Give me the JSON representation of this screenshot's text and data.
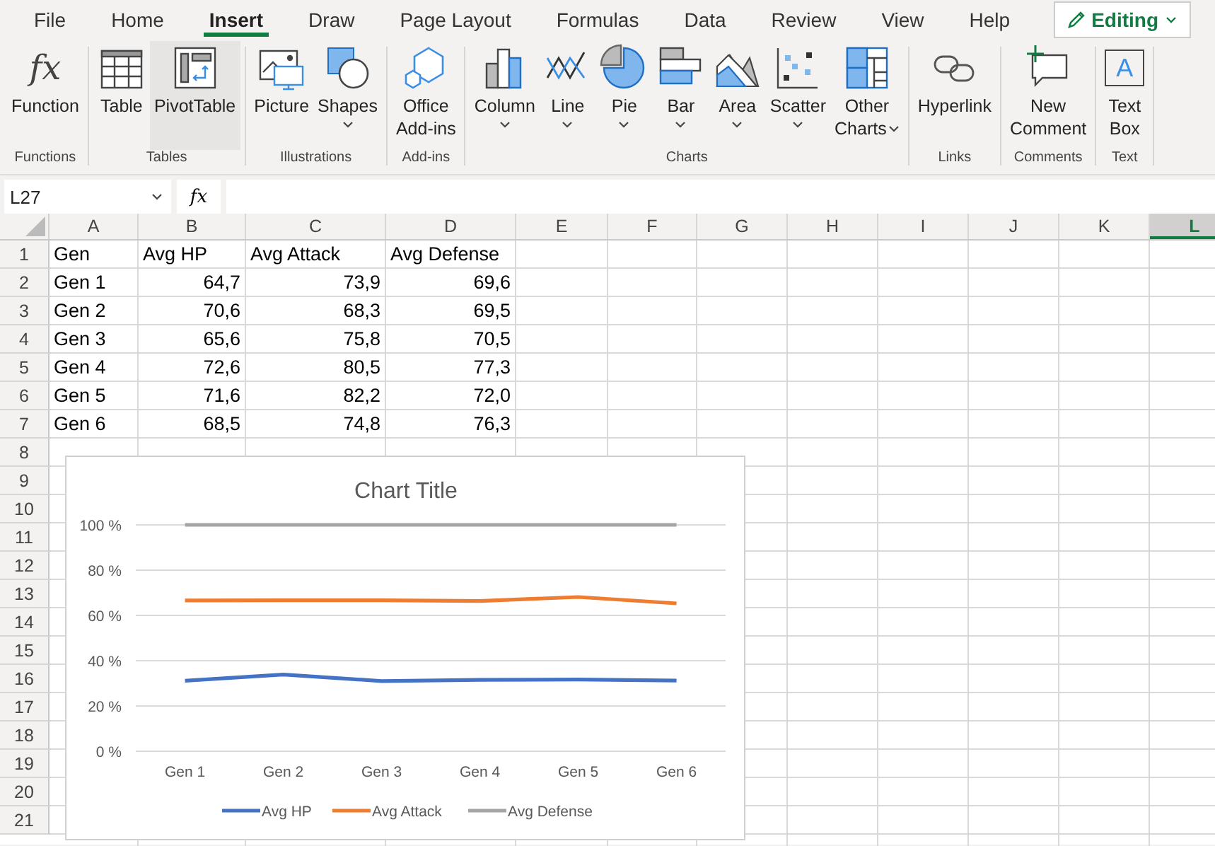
{
  "menu_tabs": [
    {
      "label": "File",
      "selected": false
    },
    {
      "label": "Home",
      "selected": false
    },
    {
      "label": "Insert",
      "selected": true
    },
    {
      "label": "Draw",
      "selected": false
    },
    {
      "label": "Page Layout",
      "selected": false
    },
    {
      "label": "Formulas",
      "selected": false
    },
    {
      "label": "Data",
      "selected": false
    },
    {
      "label": "Review",
      "selected": false
    },
    {
      "label": "View",
      "selected": false
    },
    {
      "label": "Help",
      "selected": false
    }
  ],
  "mode_button": {
    "label": "Editing"
  },
  "ribbon_groups": [
    {
      "label": "Functions",
      "items": [
        {
          "lines": [
            "Function"
          ],
          "glyph": "fx",
          "dropdown": false,
          "selected": false
        }
      ]
    },
    {
      "label": "Tables",
      "items": [
        {
          "lines": [
            "Table"
          ],
          "dropdown": false,
          "selected": false
        },
        {
          "lines": [
            "PivotTable"
          ],
          "dropdown": false,
          "selected": true
        }
      ]
    },
    {
      "label": "Illustrations",
      "items": [
        {
          "lines": [
            "Picture"
          ],
          "dropdown": false,
          "selected": false
        },
        {
          "lines": [
            "Shapes"
          ],
          "dropdown": true,
          "caret_inline": false,
          "selected": false
        }
      ]
    },
    {
      "label": "Add-ins",
      "items": [
        {
          "lines": [
            "Office",
            "Add-ins"
          ],
          "dropdown": false,
          "selected": false
        }
      ]
    },
    {
      "label": "Charts",
      "items": [
        {
          "lines": [
            "Column"
          ],
          "dropdown": true,
          "caret_inline": false,
          "selected": false
        },
        {
          "lines": [
            "Line"
          ],
          "dropdown": true,
          "caret_inline": false,
          "selected": false
        },
        {
          "lines": [
            "Pie"
          ],
          "dropdown": true,
          "caret_inline": false,
          "selected": false
        },
        {
          "lines": [
            "Bar"
          ],
          "dropdown": true,
          "caret_inline": false,
          "selected": false
        },
        {
          "lines": [
            "Area"
          ],
          "dropdown": true,
          "caret_inline": false,
          "selected": false
        },
        {
          "lines": [
            "Scatter"
          ],
          "dropdown": true,
          "caret_inline": false,
          "selected": false
        },
        {
          "lines": [
            "Other",
            "Charts"
          ],
          "dropdown": true,
          "caret_inline": true,
          "selected": false
        }
      ]
    },
    {
      "label": "Links",
      "items": [
        {
          "lines": [
            "Hyperlink"
          ],
          "dropdown": false,
          "selected": false
        }
      ]
    },
    {
      "label": "Comments",
      "items": [
        {
          "lines": [
            "New",
            "Comment"
          ],
          "dropdown": false,
          "selected": false
        }
      ]
    },
    {
      "label": "Text",
      "items": [
        {
          "lines": [
            "Text",
            "Box"
          ],
          "glyph": "A",
          "dropdown": false,
          "selected": false
        }
      ]
    }
  ],
  "formula_bar": {
    "name_box": "L27",
    "fx": "fx"
  },
  "sheet": {
    "columns": [
      {
        "label": "A",
        "selected": false
      },
      {
        "label": "B",
        "selected": false
      },
      {
        "label": "C",
        "selected": false
      },
      {
        "label": "D",
        "selected": false
      },
      {
        "label": "E",
        "selected": false
      },
      {
        "label": "F",
        "selected": false
      },
      {
        "label": "G",
        "selected": false
      },
      {
        "label": "H",
        "selected": false
      },
      {
        "label": "I",
        "selected": false
      },
      {
        "label": "J",
        "selected": false
      },
      {
        "label": "K",
        "selected": false
      },
      {
        "label": "L",
        "selected": true
      }
    ],
    "row_numbers": [
      "1",
      "2",
      "3",
      "4",
      "5",
      "6",
      "7",
      "8",
      "9",
      "10",
      "11",
      "12",
      "13",
      "14",
      "15",
      "16",
      "17",
      "18",
      "19",
      "20",
      "21"
    ],
    "rows": [
      [
        "Gen",
        "Avg HP",
        "Avg Attack",
        "Avg Defense"
      ],
      [
        "Gen 1",
        "64,7",
        "73,9",
        "69,6"
      ],
      [
        "Gen 2",
        "70,6",
        "68,3",
        "69,5"
      ],
      [
        "Gen 3",
        "65,6",
        "75,8",
        "70,5"
      ],
      [
        "Gen 4",
        "72,6",
        "80,5",
        "77,3"
      ],
      [
        "Gen 5",
        "71,6",
        "82,2",
        "72,0"
      ],
      [
        "Gen 6",
        "68,5",
        "74,8",
        "76,3"
      ]
    ]
  },
  "chart": {
    "chart_data": {
      "type": "line",
      "title": "Chart Title",
      "categories": [
        "Gen 1",
        "Gen 2",
        "Gen 3",
        "Gen 4",
        "Gen 5",
        "Gen 6"
      ],
      "ylim": [
        0,
        100
      ],
      "yticks": [
        {
          "value": 0,
          "label": "0 %"
        },
        {
          "value": 20,
          "label": "20 %"
        },
        {
          "value": 40,
          "label": "40 %"
        },
        {
          "value": 60,
          "label": "60 %"
        },
        {
          "value": 80,
          "label": "80 %"
        },
        {
          "value": 100,
          "label": "100 %"
        }
      ],
      "grid": true,
      "legend": true,
      "series": [
        {
          "name": "Avg HP",
          "color": "#4472c4",
          "values": [
            31.1,
            33.9,
            31.0,
            31.5,
            31.7,
            31.2
          ]
        },
        {
          "name": "Avg Attack",
          "color": "#ed7d31",
          "values": [
            66.6,
            66.7,
            66.7,
            66.4,
            68.1,
            65.3
          ]
        },
        {
          "name": "Avg Defense",
          "color": "#a5a5a5",
          "values": [
            100,
            100,
            100,
            100,
            100,
            100
          ]
        }
      ]
    }
  }
}
